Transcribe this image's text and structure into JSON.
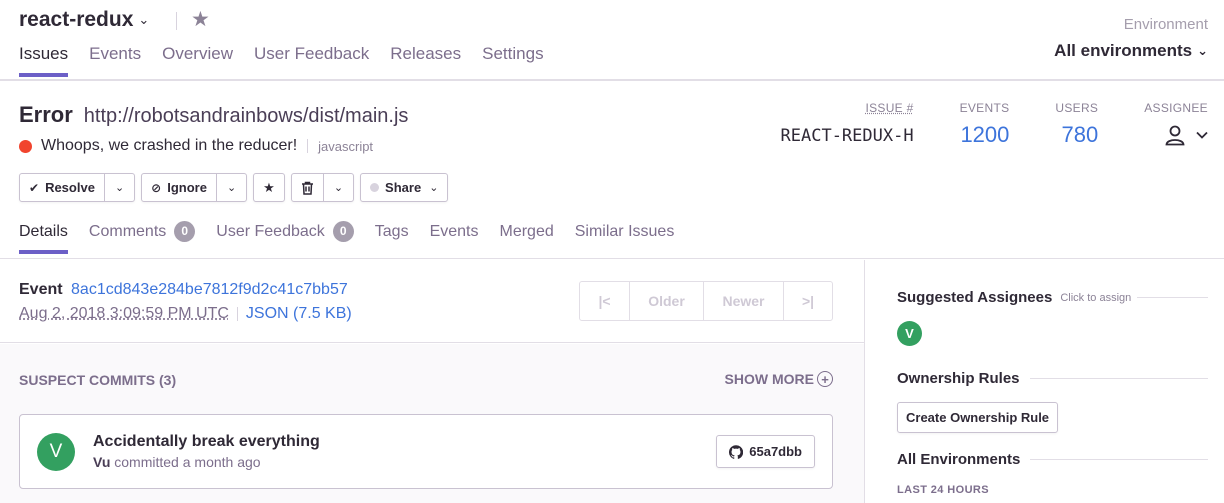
{
  "project": {
    "name": "react-redux"
  },
  "nav": {
    "tabs": [
      "Issues",
      "Events",
      "Overview",
      "User Feedback",
      "Releases",
      "Settings"
    ]
  },
  "environment": {
    "label": "Environment",
    "value": "All environments"
  },
  "issue": {
    "level": "Error",
    "culprit": "http://robotsandrainbows/dist/main.js",
    "message": "Whoops, we crashed in the reducer!",
    "platform": "javascript",
    "level_color": "#f1442e"
  },
  "stats": {
    "issue_label": "ISSUE #",
    "issue_value": "REACT-REDUX-H",
    "events_label": "EVENTS",
    "events_value": "1200",
    "users_label": "USERS",
    "users_value": "780",
    "assignee_label": "ASSIGNEE"
  },
  "actions": {
    "resolve": "Resolve",
    "ignore": "Ignore",
    "share": "Share"
  },
  "subtabs": {
    "details": "Details",
    "comments": "Comments",
    "comments_count": "0",
    "feedback": "User Feedback",
    "feedback_count": "0",
    "tags": "Tags",
    "events": "Events",
    "merged": "Merged",
    "similar": "Similar Issues"
  },
  "event": {
    "label": "Event",
    "id": "8ac1cd843e284be7812f9d2c41c7bb57",
    "date": "Aug 2, 2018 3:09:59 PM UTC",
    "json": "JSON (7.5 KB)"
  },
  "pager": {
    "first": "|<",
    "older": "Older",
    "newer": "Newer",
    "last": ">|"
  },
  "commits": {
    "title": "SUSPECT COMMITS (3)",
    "show_more": "SHOW MORE",
    "items": [
      {
        "avatar": "V",
        "message": "Accidentally break everything",
        "author": "Vu",
        "when": "committed a month ago",
        "sha": "65a7dbb"
      }
    ]
  },
  "sidebar": {
    "suggested": "Suggested Assignees",
    "click_to_assign": "Click to assign",
    "suggested_avatar": "V",
    "ownership": "Ownership Rules",
    "create_rule": "Create Ownership Rule",
    "all_envs": "All Environments",
    "last24": "LAST 24 HOURS"
  },
  "colors": {
    "accent": "#6c5fc7",
    "link": "#3d74db",
    "avatar": "#33a060"
  }
}
